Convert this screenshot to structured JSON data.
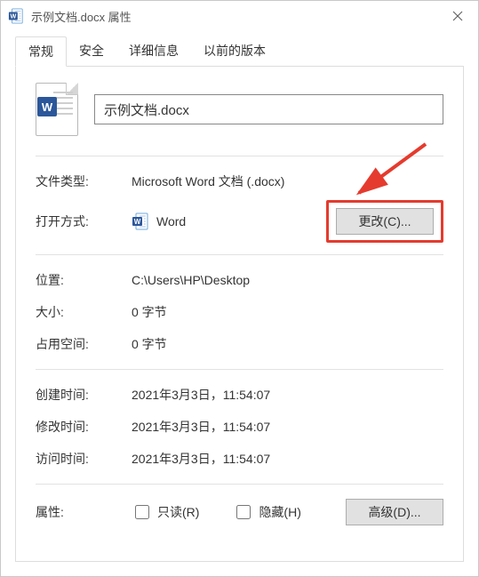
{
  "title": "示例文档.docx 属性",
  "tabs": {
    "general": "常规",
    "security": "安全",
    "details": "详细信息",
    "previous": "以前的版本"
  },
  "filename": "示例文档.docx",
  "rows": {
    "filetype_label": "文件类型:",
    "filetype_value": "Microsoft Word 文档 (.docx)",
    "openwith_label": "打开方式:",
    "openwith_value": "Word",
    "change_button": "更改(C)...",
    "location_label": "位置:",
    "location_value": "C:\\Users\\HP\\Desktop",
    "size_label": "大小:",
    "size_value": "0 字节",
    "disk_label": "占用空间:",
    "disk_value": "0 字节",
    "created_label": "创建时间:",
    "created_value": "2021年3月3日，11:54:07",
    "modified_label": "修改时间:",
    "modified_value": "2021年3月3日，11:54:07",
    "accessed_label": "访问时间:",
    "accessed_value": "2021年3月3日，11:54:07",
    "attr_label": "属性:",
    "readonly_label": "只读(R)",
    "hidden_label": "隐藏(H)",
    "advanced_button": "高级(D)..."
  },
  "icons": {
    "word_letter": "W"
  },
  "colors": {
    "highlight_border": "#e53b2e",
    "word_blue": "#2b579a"
  }
}
